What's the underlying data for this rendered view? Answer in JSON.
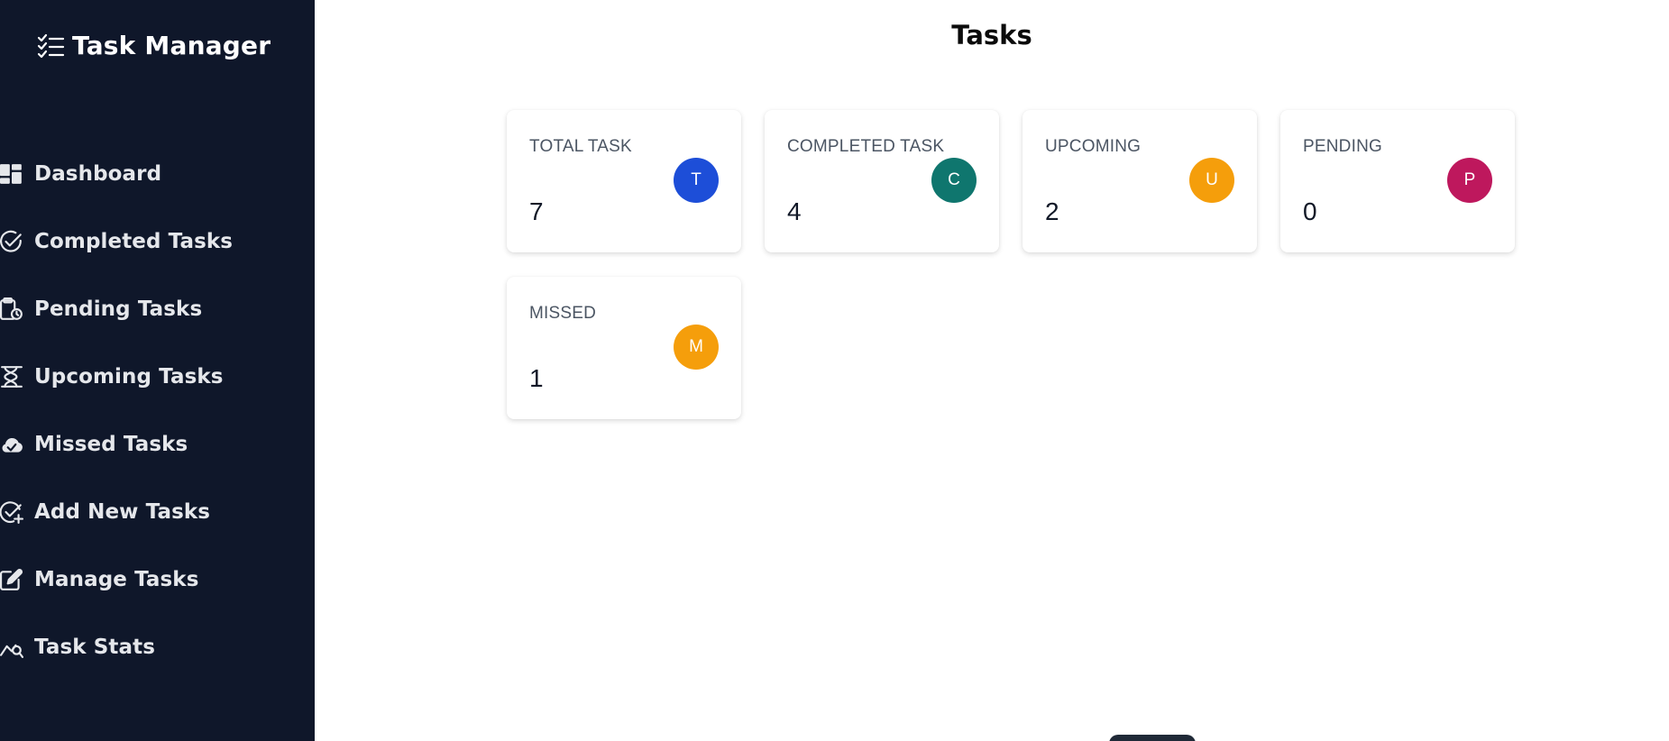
{
  "app": {
    "title": "Task Manager"
  },
  "sidebar": {
    "items": [
      {
        "label": "Dashboard",
        "icon": "dashboard-icon"
      },
      {
        "label": "Completed Tasks",
        "icon": "check-circle-icon"
      },
      {
        "label": "Pending Tasks",
        "icon": "clipboard-clock-icon"
      },
      {
        "label": "Upcoming Tasks",
        "icon": "hourglass-icon"
      },
      {
        "label": "Missed Tasks",
        "icon": "cloud-check-icon"
      },
      {
        "label": "Add New Tasks",
        "icon": "check-plus-icon"
      },
      {
        "label": "Manage Tasks",
        "icon": "edit-icon"
      },
      {
        "label": "Task Stats",
        "icon": "chart-search-icon"
      }
    ]
  },
  "main": {
    "title": "Tasks",
    "cards": [
      {
        "label": "TOTAL TASK",
        "value": "7",
        "avatar": "T",
        "color": "#1d4ed8"
      },
      {
        "label": "COMPLETED TASK",
        "value": "4",
        "avatar": "C",
        "color": "#0f766e"
      },
      {
        "label": "UPCOMING",
        "value": "2",
        "avatar": "U",
        "color": "#f59e0b"
      },
      {
        "label": "PENDING",
        "value": "0",
        "avatar": "P",
        "color": "#be185d"
      },
      {
        "label": "MISSED",
        "value": "1",
        "avatar": "M",
        "color": "#f59e0b"
      }
    ]
  }
}
